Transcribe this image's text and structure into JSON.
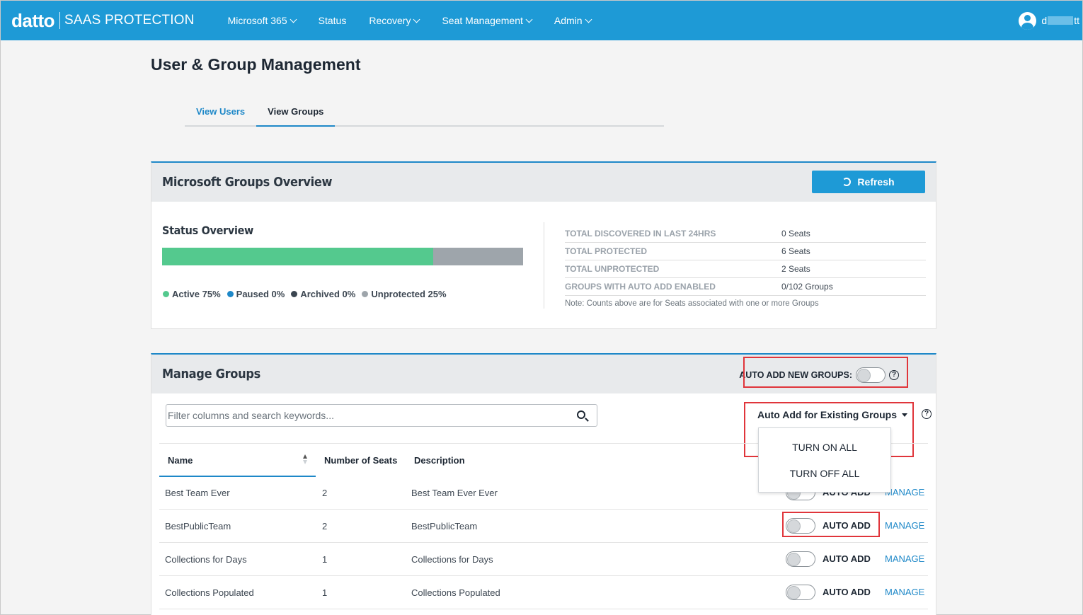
{
  "header": {
    "brand_logo": "datto",
    "brand_product": "SAAS PROTECTION",
    "nav": [
      {
        "label": "Microsoft 365",
        "dropdown": true
      },
      {
        "label": "Status",
        "dropdown": false
      },
      {
        "label": "Recovery",
        "dropdown": true
      },
      {
        "label": "Seat Management",
        "dropdown": true
      },
      {
        "label": "Admin",
        "dropdown": true
      }
    ],
    "user_prefix": "d",
    "user_suffix": "tt"
  },
  "page": {
    "title": "User & Group Management",
    "tabs": [
      {
        "label": "View Users",
        "active": false
      },
      {
        "label": "View Groups",
        "active": true
      }
    ]
  },
  "overview": {
    "title": "Microsoft Groups Overview",
    "refresh_label": "Refresh",
    "status_title": "Status Overview",
    "bar": {
      "active_pct": 75,
      "unprotected_pct": 25
    },
    "legend": [
      {
        "label": "Active 75%",
        "color": "#54c98e"
      },
      {
        "label": "Paused 0%",
        "color": "#1e88c8"
      },
      {
        "label": "Archived 0%",
        "color": "#3a4550"
      },
      {
        "label": "Unprotected 25%",
        "color": "#9ea5ab"
      }
    ],
    "stats": [
      {
        "label": "TOTAL DISCOVERED IN LAST 24HRS",
        "value": "0 Seats"
      },
      {
        "label": "TOTAL PROTECTED",
        "value": "6 Seats"
      },
      {
        "label": "TOTAL UNPROTECTED",
        "value": "2 Seats"
      },
      {
        "label": "GROUPS WITH AUTO ADD ENABLED",
        "value": "0/102 Groups"
      }
    ],
    "note": "Note: Counts above are for Seats associated with one or more Groups"
  },
  "manage": {
    "title": "Manage Groups",
    "auto_new_label": "AUTO ADD NEW GROUPS:",
    "search_placeholder": "Filter columns and search keywords...",
    "auto_existing_label": "Auto Add for Existing Groups",
    "dropdown": [
      "TURN ON ALL",
      "TURN OFF ALL"
    ],
    "columns": {
      "name": "Name",
      "seats": "Number of Seats",
      "description": "Description"
    },
    "toggle_label": "AUTO ADD",
    "manage_label": "MANAGE",
    "rows": [
      {
        "name": "Best Team Ever",
        "seats": "2",
        "description": "Best Team Ever Ever"
      },
      {
        "name": "BestPublicTeam",
        "seats": "2",
        "description": "BestPublicTeam"
      },
      {
        "name": "Collections for Days",
        "seats": "1",
        "description": "Collections for Days"
      },
      {
        "name": "Collections Populated",
        "seats": "1",
        "description": "Collections Populated"
      }
    ]
  },
  "colors": {
    "brand": "#1e9ad6",
    "accent": "#1e88c8",
    "highlight_box": "#e0353b"
  }
}
